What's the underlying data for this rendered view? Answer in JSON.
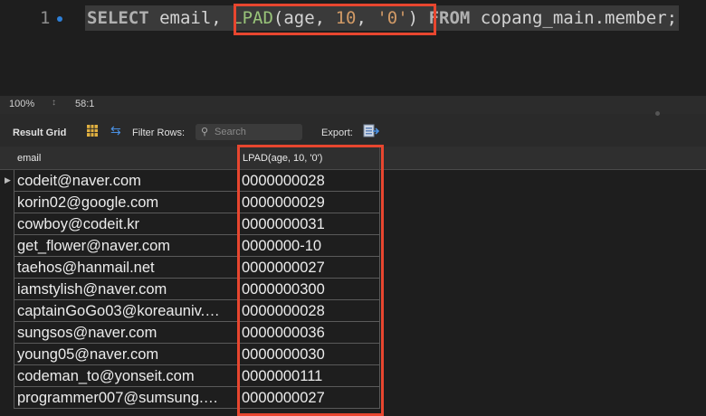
{
  "editor": {
    "line_number": "1",
    "tokens": {
      "select": "SELECT",
      "email_col": " email, ",
      "lpad_fn": "LPAD",
      "paren_open": "(age, ",
      "arg_len": "10",
      "comma": ", ",
      "arg_pad": "'0'",
      "paren_close": ")",
      "from": " FROM",
      "table": " copang_main",
      "dot_member": ".member;"
    }
  },
  "statusbar": {
    "zoom": "100%",
    "cursor_position": "58:1"
  },
  "toolbar": {
    "result_grid_label": "Result Grid",
    "filter_rows_label": "Filter Rows:",
    "search_placeholder": "Search",
    "export_label": "Export:"
  },
  "grid": {
    "columns": [
      "email",
      "LPAD(age, 10, '0')"
    ],
    "rows": [
      {
        "email": "codeit@naver.com",
        "lpad": "0000000028"
      },
      {
        "email": "korin02@google.com",
        "lpad": "0000000029"
      },
      {
        "email": "cowboy@codeit.kr",
        "lpad": "0000000031"
      },
      {
        "email": "get_flower@naver.com",
        "lpad": "0000000-10"
      },
      {
        "email": "taehos@hanmail.net",
        "lpad": "0000000027"
      },
      {
        "email": "iamstylish@naver.com",
        "lpad": "0000000300"
      },
      {
        "email": "captainGoGo03@koreauniv.…",
        "lpad": "0000000028"
      },
      {
        "email": "sungsos@naver.com",
        "lpad": "0000000036"
      },
      {
        "email": "young05@naver.com",
        "lpad": "0000000030"
      },
      {
        "email": "codeman_to@yonseit.com",
        "lpad": "0000000111"
      },
      {
        "email": "programmer007@sumsung.…",
        "lpad": "0000000027"
      }
    ]
  },
  "colors": {
    "highlight": "#e8462f",
    "editor_bg": "#1e1e1e",
    "function_green": "#98c379",
    "number_orange": "#d19a66"
  }
}
